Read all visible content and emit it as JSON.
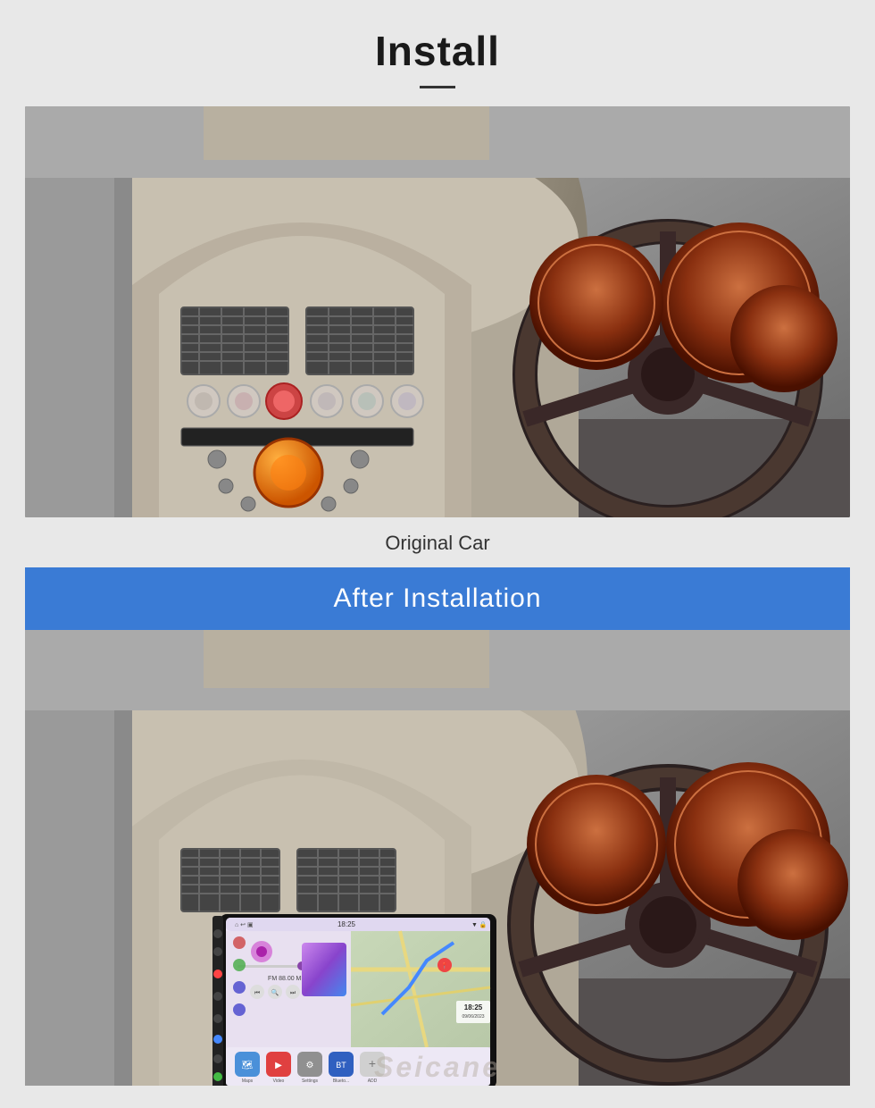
{
  "header": {
    "title": "Install",
    "divider": true
  },
  "original_car": {
    "caption": "Original Car",
    "alt": "Original car interior before installation"
  },
  "after_install": {
    "banner_text": "After  Installation",
    "alt": "Car interior after Android radio installation",
    "screen": {
      "time": "18:25",
      "date": "09/06/2023",
      "radio_freq": "FM 88.00 MHz",
      "apps": [
        {
          "label": "Maps",
          "color": "#4a90d9"
        },
        {
          "label": "Video",
          "color": "#e04040"
        },
        {
          "label": "Settings",
          "color": "#909090"
        },
        {
          "label": "Blueto...",
          "color": "#3060c0"
        },
        {
          "label": "ADD",
          "color": "#d0d0d0"
        }
      ]
    }
  },
  "watermark": {
    "text": "Seicane"
  },
  "brand": {
    "accent_blue": "#3a7bd5",
    "text_dark": "#1a1a1a"
  }
}
